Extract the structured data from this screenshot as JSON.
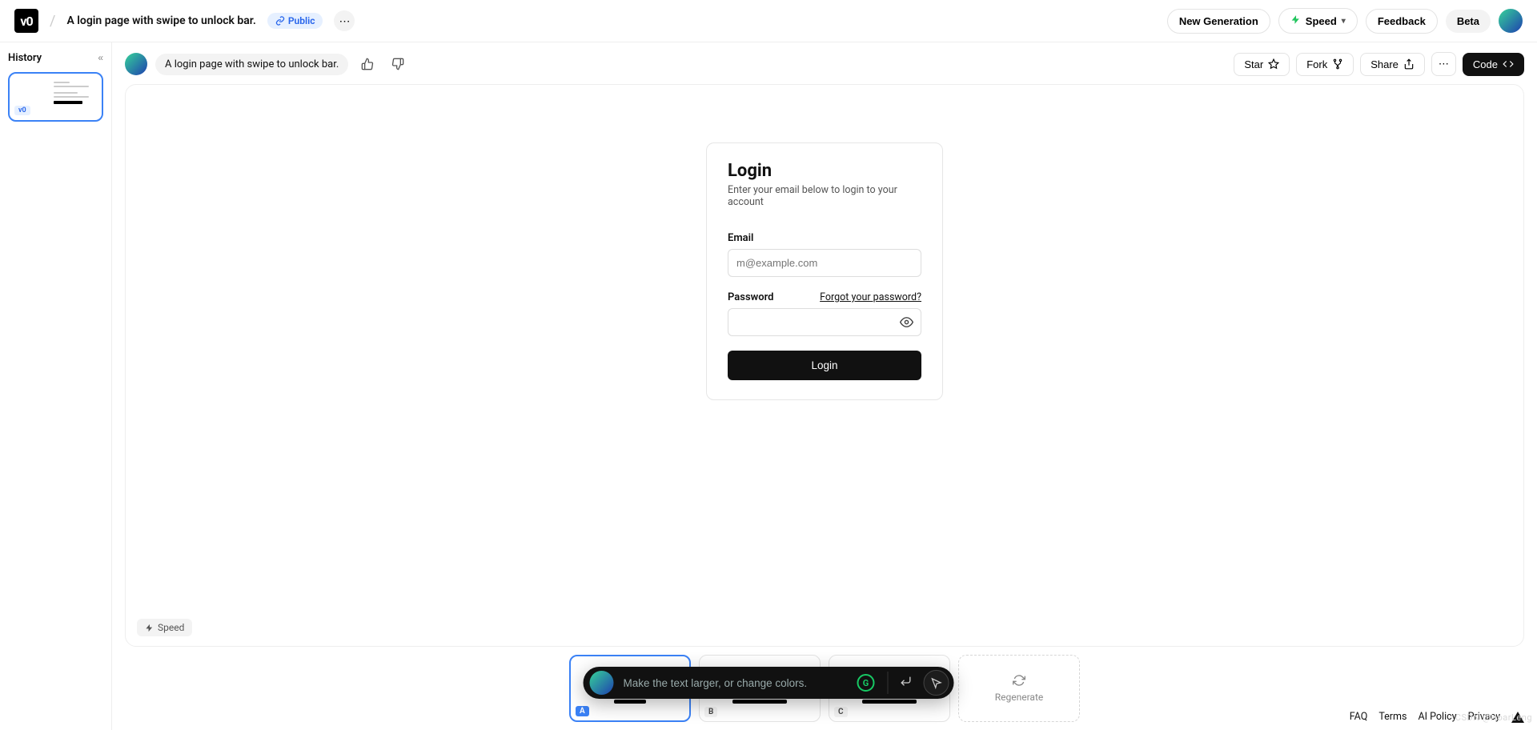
{
  "header": {
    "logo": "v0",
    "title": "A login page with swipe to unlock bar.",
    "public_badge": "Public",
    "new_generation": "New Generation",
    "speed": "Speed",
    "feedback": "Feedback",
    "beta": "Beta"
  },
  "sidebar": {
    "history": "History",
    "thumb_badge": "v0"
  },
  "canvas": {
    "prompt": "A login page with swipe to unlock bar.",
    "star": "Star",
    "fork": "Fork",
    "share": "Share",
    "code": "Code",
    "speed_tag": "Speed"
  },
  "login": {
    "title": "Login",
    "subtitle": "Enter your email below to login to your account",
    "email_label": "Email",
    "email_placeholder": "m@example.com",
    "password_label": "Password",
    "forgot": "Forgot your password?",
    "submit": "Login"
  },
  "variants": {
    "a": "A",
    "b": "B",
    "c": "C",
    "regenerate": "Regenerate"
  },
  "prompt_bar": {
    "placeholder": "Make the text larger, or change colors."
  },
  "footer": {
    "faq": "FAQ",
    "terms": "Terms",
    "ai_policy": "AI Policy",
    "privacy": "Privacy"
  },
  "watermark": "CSDN @HoarLeng"
}
